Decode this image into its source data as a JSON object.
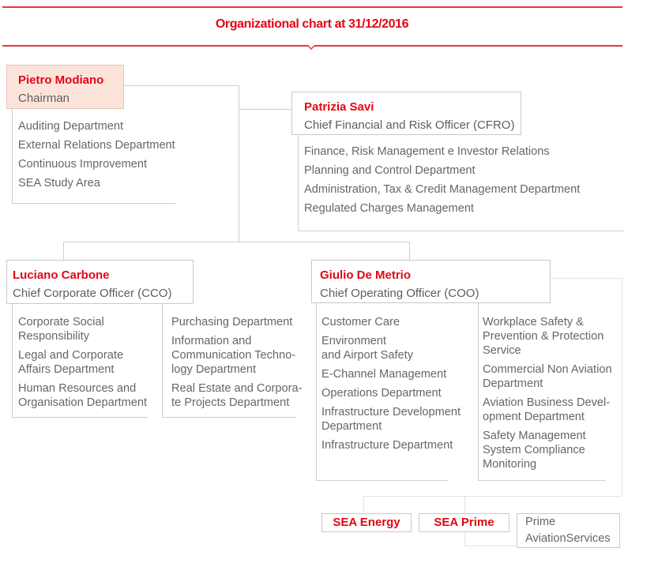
{
  "header": {
    "title": "Organizational chart at 31/12/2016"
  },
  "colors": {
    "accent_red": "#e30613",
    "chairman_fill": "#fde4db",
    "line_gray": "#cfcfcf",
    "text_gray": "#666666"
  },
  "chairman": {
    "name": "Pietro Modiano",
    "role": "Chairman",
    "departments": [
      "Auditing Department",
      "External Relations Department",
      "Continuous Improvement",
      "SEA Study Area"
    ]
  },
  "cfro": {
    "name": "Patrizia Savi",
    "role": "Chief Financial and Risk Officer (CFRO)",
    "departments": [
      "Finance, Risk Management e Investor Relations",
      "Planning and Control Department",
      "Administration, Tax & Credit Management Department",
      "Regulated Charges Management"
    ]
  },
  "cco": {
    "name": "Luciano Carbone",
    "role": "Chief Corporate Officer (CCO)",
    "departments_left": [
      "Corporate Social\nResponsibility",
      "Legal and Corporate\nAffairs Department",
      "Human Resources and\nOrganisation Department"
    ],
    "departments_right": [
      "Purchasing Department",
      "Information and\nCommunication Techno-\nlogy Department",
      "Real Estate and Corpora-\nte Projects Department"
    ]
  },
  "coo": {
    "name": "Giulio De Metrio",
    "role": "Chief Operating Officer (COO)",
    "departments_left": [
      "Customer Care",
      "Environment\nand Airport Safety",
      "E-Channel Management",
      "Operations Department",
      "Infrastructure Development\nDepartment",
      "Infrastructure Department"
    ],
    "departments_right": [
      "Workplace Safety &\nPrevention & Protection\nService",
      "Commercial Non Aviation\nDepartment",
      "Aviation Business Devel-\nopment Department",
      "Safety Management\nSystem Compliance\nMonitoring"
    ]
  },
  "subsidiaries": {
    "sea_energy": "SEA Energy",
    "sea_prime": "SEA Prime",
    "prime_aviation": "Prime\nAviationServices"
  }
}
